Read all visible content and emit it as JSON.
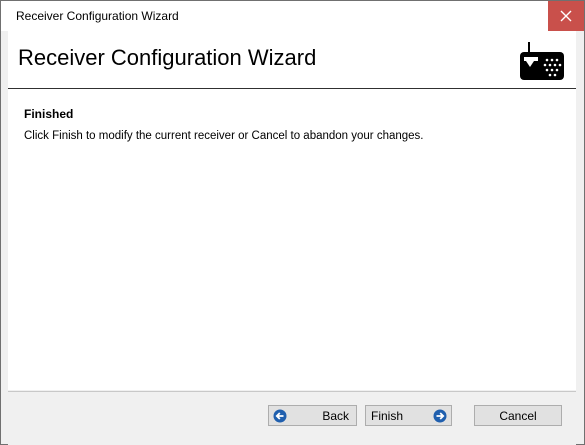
{
  "window": {
    "title": "Receiver Configuration Wizard",
    "close_glyph": "✕"
  },
  "header": {
    "title": "Receiver Configuration Wizard",
    "icon": "radio-receiver-icon"
  },
  "step": {
    "title": "Finished",
    "description": "Click Finish to modify the current receiver or Cancel to abandon your changes."
  },
  "buttons": {
    "back": "Back",
    "finish": "Finish",
    "cancel": "Cancel"
  },
  "colors": {
    "close_bg": "#c9504b",
    "arrow_blue": "#1f5fae"
  }
}
